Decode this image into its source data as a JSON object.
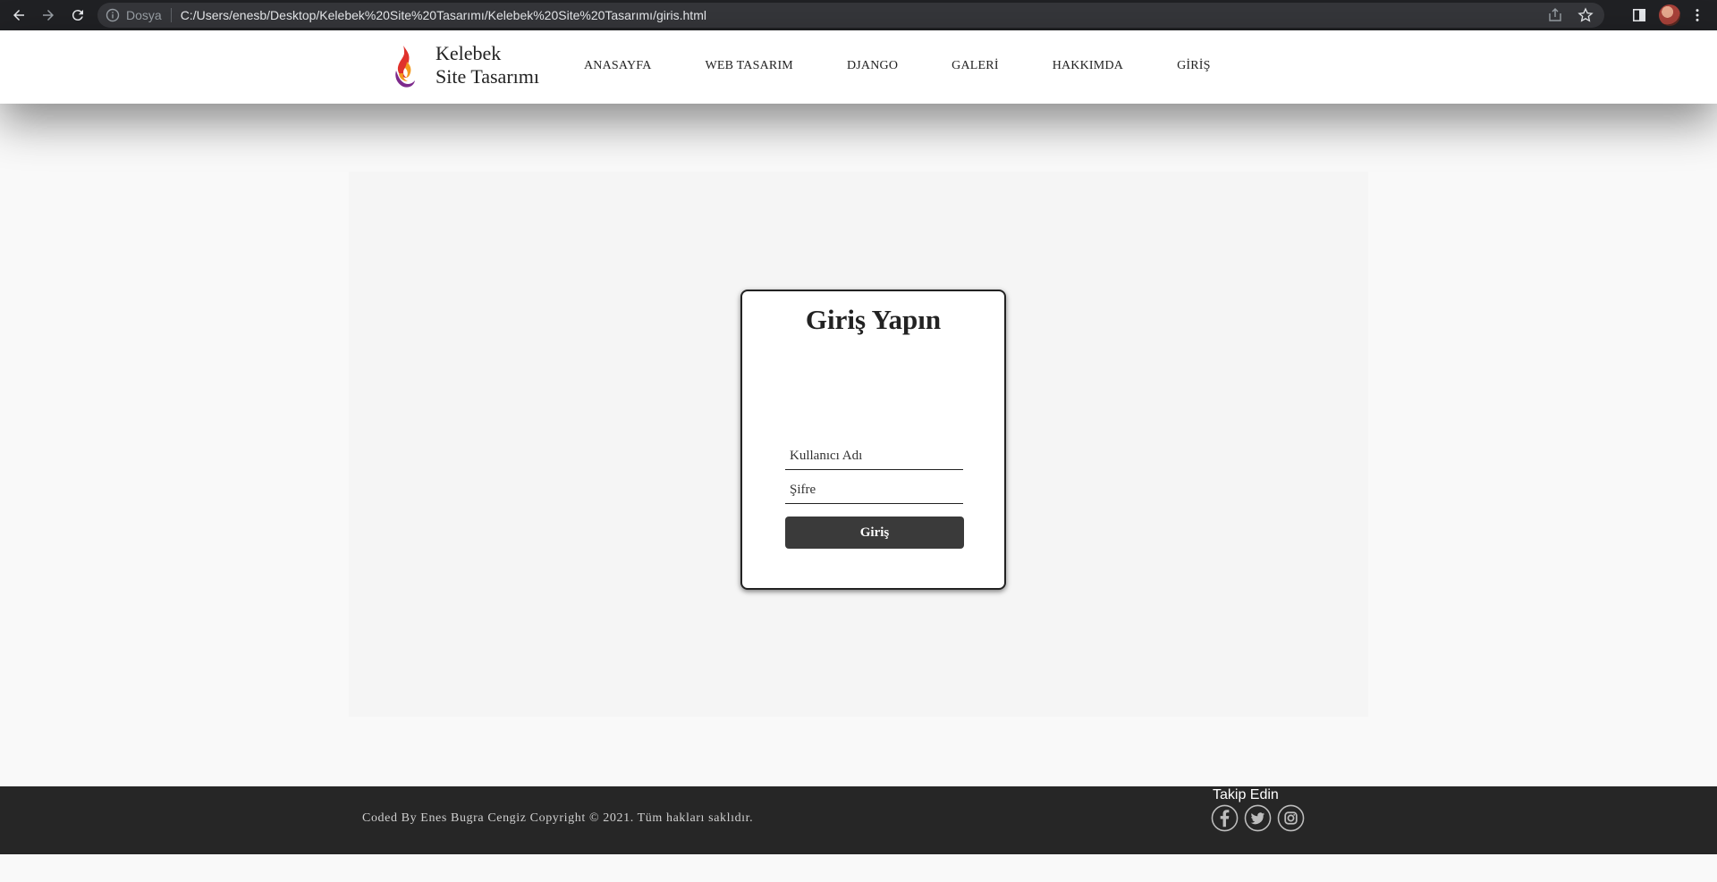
{
  "browser": {
    "scheme_label": "Dosya",
    "url": "C:/Users/enesb/Desktop/Kelebek%20Site%20Tasarımı/Kelebek%20Site%20Tasarımı/giris.html"
  },
  "header": {
    "logo_line1": "Kelebek",
    "logo_line2": "Site Tasarımı",
    "nav": [
      "ANASAYFA",
      "WEB TASARIM",
      "DJANGO",
      "GALERİ",
      "HAKKIMDA",
      "GİRİŞ"
    ]
  },
  "login": {
    "title": "Giriş Yapın",
    "username_placeholder": "Kullanıcı Adı",
    "password_placeholder": "Şifre",
    "submit_label": "Giriş"
  },
  "footer": {
    "copyright": "Coded By Enes Bugra Cengiz Copyright © 2021. Tüm hakları saklıdır.",
    "follow_label": "Takip Edin",
    "socials": [
      "facebook-icon",
      "twitter-icon",
      "instagram-icon"
    ]
  },
  "colors": {
    "chrome_bg": "#202124",
    "omnibox_bg": "#35363a",
    "footer_bg": "#262626",
    "button_bg": "#3a3a3a",
    "logo_red": "#e0322c",
    "logo_orange": "#f39a1e",
    "logo_purple": "#7d2a8c"
  }
}
